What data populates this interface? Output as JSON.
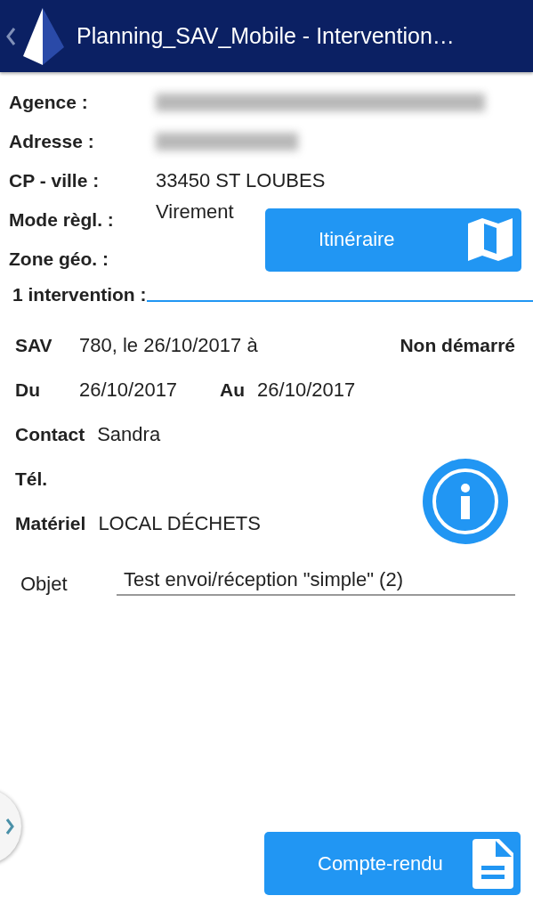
{
  "header": {
    "title": "Planning_SAV_Mobile - Intervention…"
  },
  "client": [
    {
      "label": "Agence :",
      "redacted": true
    },
    {
      "label": "Adresse :",
      "redacted": true
    },
    {
      "label": "CP - ville :",
      "value": "33450 ST LOUBES"
    },
    {
      "label": "Mode règl. :",
      "value": "Virement"
    },
    {
      "label": "Zone géo. :"
    }
  ],
  "itinerary_button": "Itinéraire",
  "section_title": "1 intervention :",
  "intervention": {
    "sav_label": "SAV",
    "sav_value": "780, le 26/10/2017 à",
    "status": "Non démarré",
    "du_label": "Du",
    "du_value": "26/10/2017",
    "au_label": "Au",
    "au_value": "26/10/2017",
    "contact_label": "Contact",
    "contact_value": "Sandra",
    "tel_label": "Tél.",
    "materiel_label": "Matériel",
    "materiel_value": "LOCAL DÉCHETS",
    "objet_label": "Objet",
    "objet_value": "Test envoi/réception \"simple\" (2)"
  },
  "report_button": "Compte-rendu"
}
